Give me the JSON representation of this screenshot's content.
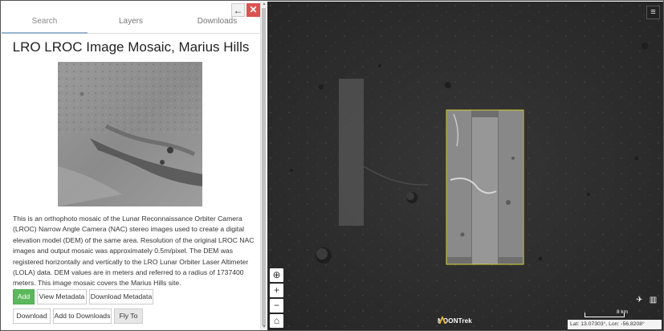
{
  "tabs": [
    {
      "label": "Search"
    },
    {
      "label": "Layers"
    },
    {
      "label": "Downloads"
    }
  ],
  "panel": {
    "title": "LRO LROC Image Mosaic, Marius Hills",
    "back_icon": "←",
    "close_icon": "✕",
    "description": "This is an orthophoto mosaic of the Lunar Reconnaissance Orbiter Camera (LROC) Narrow Angle Camera (NAC) stereo images used to create a digital elevation model (DEM) of the same area. Resolution of the original LROC NAC images and output mosaic was approximately 0.5m/pixel. The DEM was registered horizontally and vertically to the LRO Lunar Orbiter Laser Altimeter (LOLA) data. DEM values are in meters and referred to a radius of 1737400 meters. This image mosaic covers the Marius Hills site.",
    "buttons": {
      "add": "Add",
      "view_metadata": "View Metadata",
      "download_metadata": "Download Metadata",
      "download": "Download",
      "add_to_downloads": "Add to Downloads",
      "fly_to": "Fly To"
    }
  },
  "map": {
    "logo_text": "MOONTrek",
    "scale_label": "8 km",
    "coordinates": "Lat: 13.07303°, Lon: -56.8208°",
    "menu_icon": "≡",
    "globe_icon": "⊕",
    "zoom_in": "+",
    "zoom_out": "−",
    "home_icon": "⌂",
    "plane_icon": "✈",
    "map_icon": "▥"
  },
  "colors": {
    "accent_green": "#5cb85c",
    "close_red": "#d9534f",
    "footprint_yellow": "#d4d43a"
  }
}
